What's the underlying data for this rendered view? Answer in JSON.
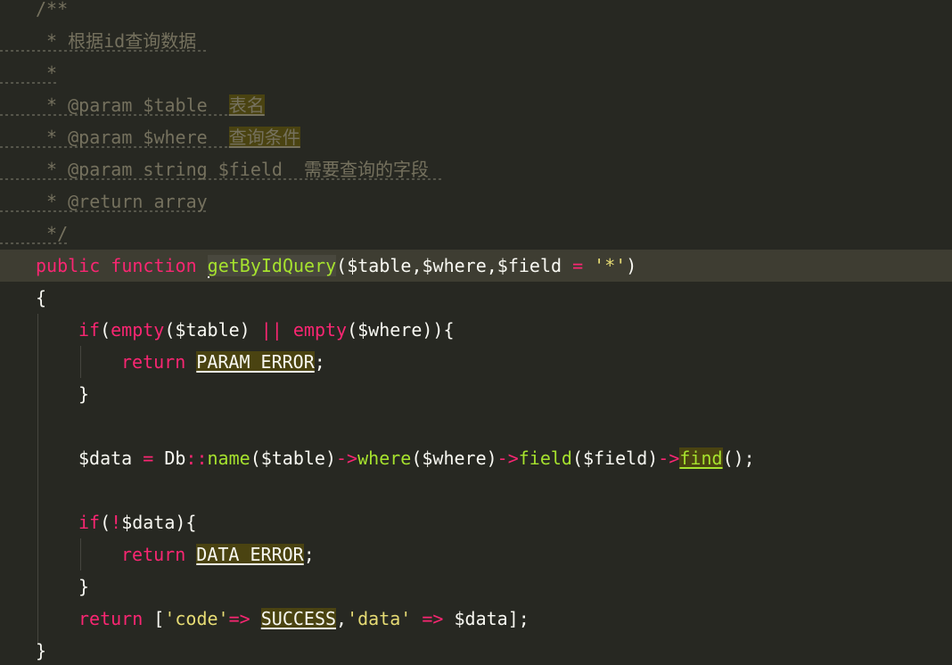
{
  "editor": {
    "lines": {
      "l1": "/**",
      "l2": " * 根据id查询数据",
      "l3": " *",
      "l4_pre": " * @param $table  ",
      "l4_hl": "表名",
      "l5_pre": " * @param $where  ",
      "l5_hl": "查询条件",
      "l6": " * @param string $field  需要查询的字段",
      "l7": " * @return array",
      "l8": " */",
      "l9": {
        "kw1": "public",
        "kw2": "function",
        "fname": "getByIdQuery",
        "params": "($table,$where,$field ",
        "eq": "=",
        "space": " ",
        "str": "'*'",
        "close": ")"
      },
      "l10": "{",
      "l11": {
        "kw": "if",
        "p1": "(",
        "empty1": "empty",
        "a1": "($table) ",
        "or": "||",
        "sp": " ",
        "empty2": "empty",
        "a2": "($where)){"
      },
      "l12": {
        "kw": "return",
        "const": "PARAM_ERROR",
        "semi": ";"
      },
      "l13": "}",
      "l15": {
        "var": "$data ",
        "eq": "=",
        "cls": " Db",
        "dc": "::",
        "m1": "name",
        "a1": "($table)",
        "ar1": "->",
        "m2": "where",
        "a2": "($where)",
        "ar2": "->",
        "m3": "field",
        "a3": "($field)",
        "ar3": "->",
        "m4": "find",
        "end": "();"
      },
      "l17": {
        "kw": "if",
        "p1": "(",
        "not": "!",
        "rest": "$data){"
      },
      "l18": {
        "kw": "return",
        "const": "DATA_ERROR",
        "semi": ";"
      },
      "l19": "}",
      "l20": {
        "kw": "return",
        "b1": " [",
        "s1": "'code'",
        "ar1": "=>",
        "sp": " ",
        "const": "SUCCESS",
        "c": ",",
        "s2": "'data'",
        "sp2": " ",
        "ar2": "=>",
        "rest": " $data];"
      },
      "l21": "}"
    }
  }
}
